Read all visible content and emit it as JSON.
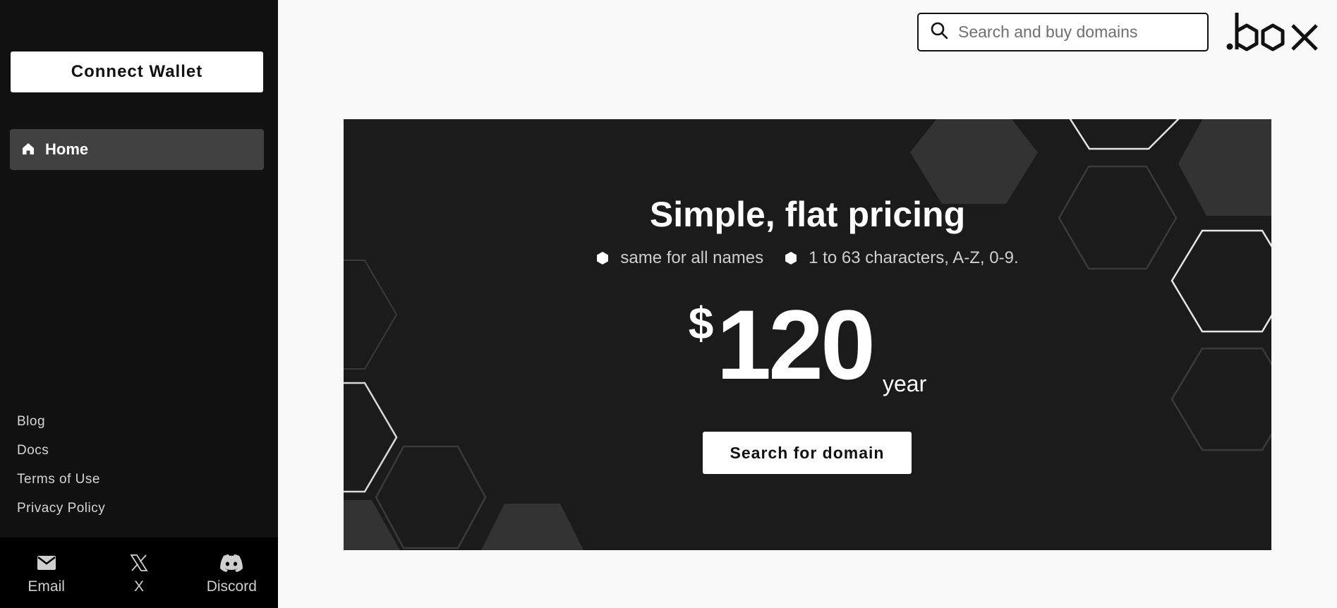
{
  "sidebar": {
    "connect_label": "Connect Wallet",
    "nav": [
      {
        "label": "Home",
        "icon": "home-icon"
      }
    ],
    "footer_links": [
      "Blog",
      "Docs",
      "Terms of Use",
      "Privacy Policy"
    ],
    "social": [
      {
        "label": "Email",
        "icon": "mail-icon"
      },
      {
        "label": "X",
        "icon": "x-icon"
      },
      {
        "label": "Discord",
        "icon": "discord-icon"
      }
    ]
  },
  "header": {
    "search_placeholder": "Search and buy domains",
    "logo_text": ".box"
  },
  "hero": {
    "title": "Simple, flat pricing",
    "bullets": [
      "same for all names",
      "1 to 63 characters, A-Z, 0-9."
    ],
    "currency": "$",
    "price": "120",
    "unit": "year",
    "cta_label": "Search for domain"
  },
  "colors": {
    "sidebar_bg": "#111111",
    "nav_active_bg": "#414141",
    "hero_bg": "#1b1b1b",
    "page_bg": "#f9f9f9"
  }
}
